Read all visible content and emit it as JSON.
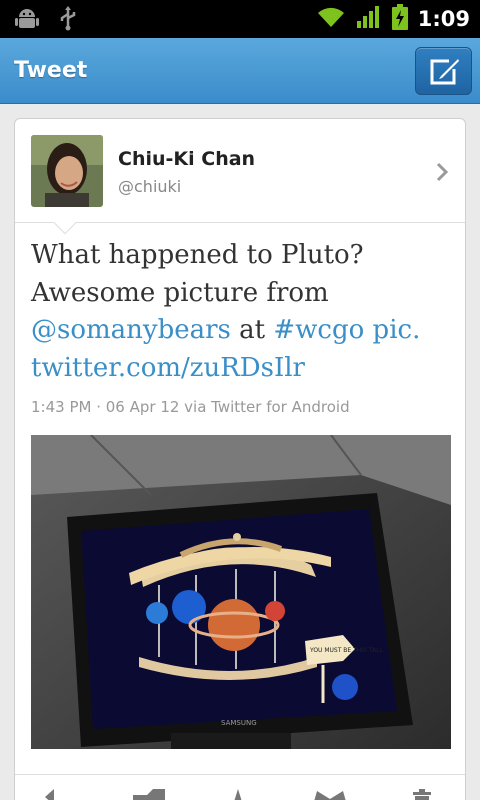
{
  "status_bar": {
    "time": "1:09",
    "icons": [
      "android-debug-icon",
      "usb-icon",
      "wifi-icon",
      "signal-icon",
      "battery-charging-icon"
    ]
  },
  "action_bar": {
    "title": "Tweet",
    "compose_icon": "compose-icon"
  },
  "tweet": {
    "author": {
      "name": "Chiu-Ki Chan",
      "handle": "@chiuki"
    },
    "text": {
      "line1": "What happened to Pluto?",
      "line2": "Awesome picture from",
      "mention": "@somanybears",
      "at": " at ",
      "hashtag": "#wcgo",
      "link_part1": " pic.",
      "link_part2": "twitter.com/zuRDsIlr"
    },
    "meta": "1:43 PM · 06 Apr 12 via Twitter for Android",
    "photo_sign": "YOU MUST BE THIS TALL",
    "tv_brand": "SAMSUNG"
  },
  "toolbar": {
    "icons": [
      "reply-icon",
      "retweet-icon",
      "favorite-icon",
      "share-icon",
      "delete-icon"
    ]
  },
  "colors": {
    "link": "#3a8fc8",
    "action_bar": "#4a9bd4"
  }
}
